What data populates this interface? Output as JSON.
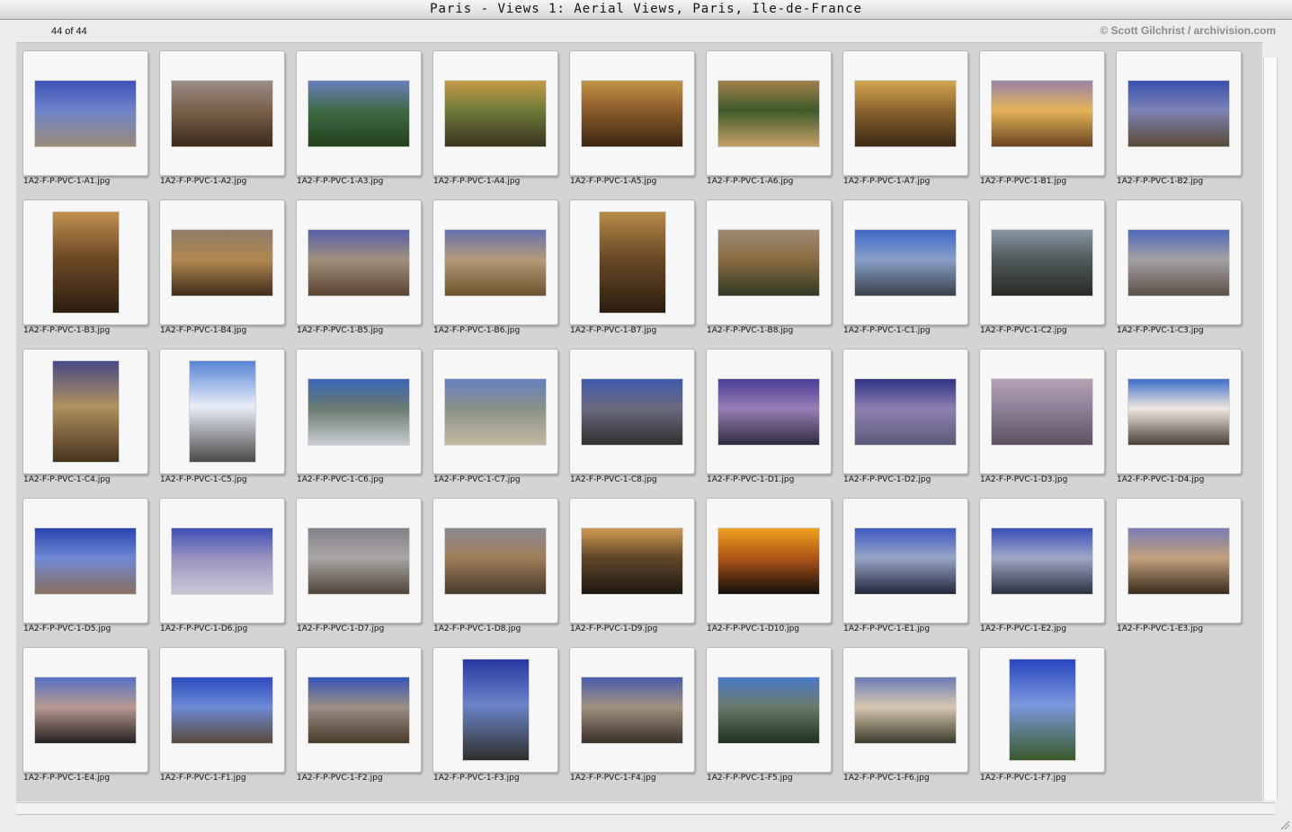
{
  "window": {
    "title": "Paris - Views 1: Aerial Views, Paris, Ile-de-France"
  },
  "header": {
    "count": "44 of 44",
    "credit": "© Scott Gilchrist / archivision.com"
  },
  "thumbnails": [
    {
      "file": "1A2-F-P-PVC-1-A1.jpg",
      "orientation": "landscape",
      "colors": [
        "#3c52b8",
        "#6f83c9",
        "#9c8a78"
      ]
    },
    {
      "file": "1A2-F-P-PVC-1-A2.jpg",
      "orientation": "landscape",
      "colors": [
        "#9c8d86",
        "#7a6048",
        "#3d2a1c"
      ]
    },
    {
      "file": "1A2-F-P-PVC-1-A3.jpg",
      "orientation": "landscape",
      "colors": [
        "#6a7ec0",
        "#3e6a44",
        "#23401f"
      ]
    },
    {
      "file": "1A2-F-P-PVC-1-A4.jpg",
      "orientation": "landscape",
      "colors": [
        "#c59a45",
        "#6e7a38",
        "#3a3420"
      ]
    },
    {
      "file": "1A2-F-P-PVC-1-A5.jpg",
      "orientation": "landscape",
      "colors": [
        "#c29445",
        "#8a5a2a",
        "#3c2614"
      ]
    },
    {
      "file": "1A2-F-P-PVC-1-A6.jpg",
      "orientation": "landscape",
      "colors": [
        "#a0804a",
        "#3f5a2a",
        "#c7a068"
      ]
    },
    {
      "file": "1A2-F-P-PVC-1-A7.jpg",
      "orientation": "landscape",
      "colors": [
        "#d2a650",
        "#8c6230",
        "#3a2a16"
      ]
    },
    {
      "file": "1A2-F-P-PVC-1-B1.jpg",
      "orientation": "landscape",
      "colors": [
        "#9b83a8",
        "#e3b358",
        "#6a4322"
      ]
    },
    {
      "file": "1A2-F-P-PVC-1-B2.jpg",
      "orientation": "landscape",
      "colors": [
        "#3a4fae",
        "#7d83b4",
        "#5a4a38"
      ]
    },
    {
      "file": "1A2-F-P-PVC-1-B3.jpg",
      "orientation": "portrait",
      "colors": [
        "#c09050",
        "#6e4a26",
        "#2d1e10"
      ]
    },
    {
      "file": "1A2-F-P-PVC-1-B4.jpg",
      "orientation": "landscape",
      "colors": [
        "#8f7c6a",
        "#b08850",
        "#3f2c1a"
      ]
    },
    {
      "file": "1A2-F-P-PVC-1-B5.jpg",
      "orientation": "landscape",
      "colors": [
        "#5560a8",
        "#a28f7e",
        "#5a4430"
      ]
    },
    {
      "file": "1A2-F-P-PVC-1-B6.jpg",
      "orientation": "landscape",
      "colors": [
        "#6470b0",
        "#b59a78",
        "#70532e"
      ]
    },
    {
      "file": "1A2-F-P-PVC-1-B7.jpg",
      "orientation": "portrait",
      "colors": [
        "#b88a48",
        "#6a4a26",
        "#2c1c10"
      ]
    },
    {
      "file": "1A2-F-P-PVC-1-B8.jpg",
      "orientation": "landscape",
      "colors": [
        "#9e8a74",
        "#8a6a40",
        "#2f3a22"
      ]
    },
    {
      "file": "1A2-F-P-PVC-1-C1.jpg",
      "orientation": "landscape",
      "colors": [
        "#3e68c8",
        "#8aa0c8",
        "#38404a"
      ]
    },
    {
      "file": "1A2-F-P-PVC-1-C2.jpg",
      "orientation": "landscape",
      "colors": [
        "#8a96a4",
        "#4e5a5a",
        "#2a2a26"
      ]
    },
    {
      "file": "1A2-F-P-PVC-1-C3.jpg",
      "orientation": "landscape",
      "colors": [
        "#4f69b8",
        "#a4a0a4",
        "#5c5048"
      ]
    },
    {
      "file": "1A2-F-P-PVC-1-C4.jpg",
      "orientation": "portrait",
      "colors": [
        "#474a86",
        "#b0915e",
        "#46321e"
      ]
    },
    {
      "file": "1A2-F-P-PVC-1-C5.jpg",
      "orientation": "portrait",
      "colors": [
        "#5884d6",
        "#e9eef8",
        "#4a4a4a"
      ]
    },
    {
      "file": "1A2-F-P-PVC-1-C6.jpg",
      "orientation": "landscape",
      "colors": [
        "#3a66b8",
        "#6a7a70",
        "#c8ccd2"
      ]
    },
    {
      "file": "1A2-F-P-PVC-1-C7.jpg",
      "orientation": "landscape",
      "colors": [
        "#6480c0",
        "#8a9288",
        "#c4b8a0"
      ]
    },
    {
      "file": "1A2-F-P-PVC-1-C8.jpg",
      "orientation": "landscape",
      "colors": [
        "#3f5aac",
        "#6a6a80",
        "#30302e"
      ]
    },
    {
      "file": "1A2-F-P-PVC-1-D1.jpg",
      "orientation": "landscape",
      "colors": [
        "#4a3c96",
        "#9a7eb8",
        "#2e2c40"
      ]
    },
    {
      "file": "1A2-F-P-PVC-1-D2.jpg",
      "orientation": "landscape",
      "colors": [
        "#2e3482",
        "#9080b0",
        "#5a5a7a"
      ]
    },
    {
      "file": "1A2-F-P-PVC-1-D3.jpg",
      "orientation": "landscape",
      "colors": [
        "#b7a0b4",
        "#8c8098",
        "#5c5060"
      ]
    },
    {
      "file": "1A2-F-P-PVC-1-D4.jpg",
      "orientation": "landscape",
      "colors": [
        "#3f6ec8",
        "#f0e8e0",
        "#4a4038"
      ]
    },
    {
      "file": "1A2-F-P-PVC-1-D5.jpg",
      "orientation": "landscape",
      "colors": [
        "#2a44b0",
        "#6e88d4",
        "#8a7060"
      ]
    },
    {
      "file": "1A2-F-P-PVC-1-D6.jpg",
      "orientation": "landscape",
      "colors": [
        "#3a50b4",
        "#9a92c0",
        "#c8c8d8"
      ]
    },
    {
      "file": "1A2-F-P-PVC-1-D7.jpg",
      "orientation": "landscape",
      "colors": [
        "#84808a",
        "#aaa6a6",
        "#4e4438"
      ]
    },
    {
      "file": "1A2-F-P-PVC-1-D8.jpg",
      "orientation": "landscape",
      "colors": [
        "#8c8a94",
        "#a07e58",
        "#46382a"
      ]
    },
    {
      "file": "1A2-F-P-PVC-1-D9.jpg",
      "orientation": "landscape",
      "colors": [
        "#cf9a52",
        "#604628",
        "#1f1810"
      ]
    },
    {
      "file": "1A2-F-P-PVC-1-D10.jpg",
      "orientation": "landscape",
      "colors": [
        "#f0a220",
        "#b05418",
        "#120e0a"
      ]
    },
    {
      "file": "1A2-F-P-PVC-1-E1.jpg",
      "orientation": "landscape",
      "colors": [
        "#3e5ac0",
        "#98a4c8",
        "#22283c"
      ]
    },
    {
      "file": "1A2-F-P-PVC-1-E2.jpg",
      "orientation": "landscape",
      "colors": [
        "#3850b8",
        "#a0a8c8",
        "#283040"
      ]
    },
    {
      "file": "1A2-F-P-PVC-1-E3.jpg",
      "orientation": "landscape",
      "colors": [
        "#7a7cb4",
        "#c4a07c",
        "#3a2c1e"
      ]
    },
    {
      "file": "1A2-F-P-PVC-1-E4.jpg",
      "orientation": "landscape",
      "colors": [
        "#5670c4",
        "#b89a90",
        "#242020"
      ]
    },
    {
      "file": "1A2-F-P-PVC-1-F1.jpg",
      "orientation": "landscape",
      "colors": [
        "#2e4cc0",
        "#6c8ad4",
        "#5a4a3c"
      ]
    },
    {
      "file": "1A2-F-P-PVC-1-F2.jpg",
      "orientation": "landscape",
      "colors": [
        "#3654b8",
        "#9c8e84",
        "#4a3a2c"
      ]
    },
    {
      "file": "1A2-F-P-PVC-1-F3.jpg",
      "orientation": "portrait",
      "colors": [
        "#2638a0",
        "#6a84c8",
        "#30302c"
      ]
    },
    {
      "file": "1A2-F-P-PVC-1-F4.jpg",
      "orientation": "landscape",
      "colors": [
        "#4a5eac",
        "#a09080",
        "#3a3028"
      ]
    },
    {
      "file": "1A2-F-P-PVC-1-F5.jpg",
      "orientation": "landscape",
      "colors": [
        "#4a7ac8",
        "#6a7a6a",
        "#203020"
      ]
    },
    {
      "file": "1A2-F-P-PVC-1-F6.jpg",
      "orientation": "landscape",
      "colors": [
        "#6a7cb8",
        "#d8c8b0",
        "#3a3a2a"
      ]
    },
    {
      "file": "1A2-F-P-PVC-1-F7.jpg",
      "orientation": "portrait",
      "colors": [
        "#2a46c0",
        "#7a98dc",
        "#3a5a2a"
      ]
    }
  ]
}
